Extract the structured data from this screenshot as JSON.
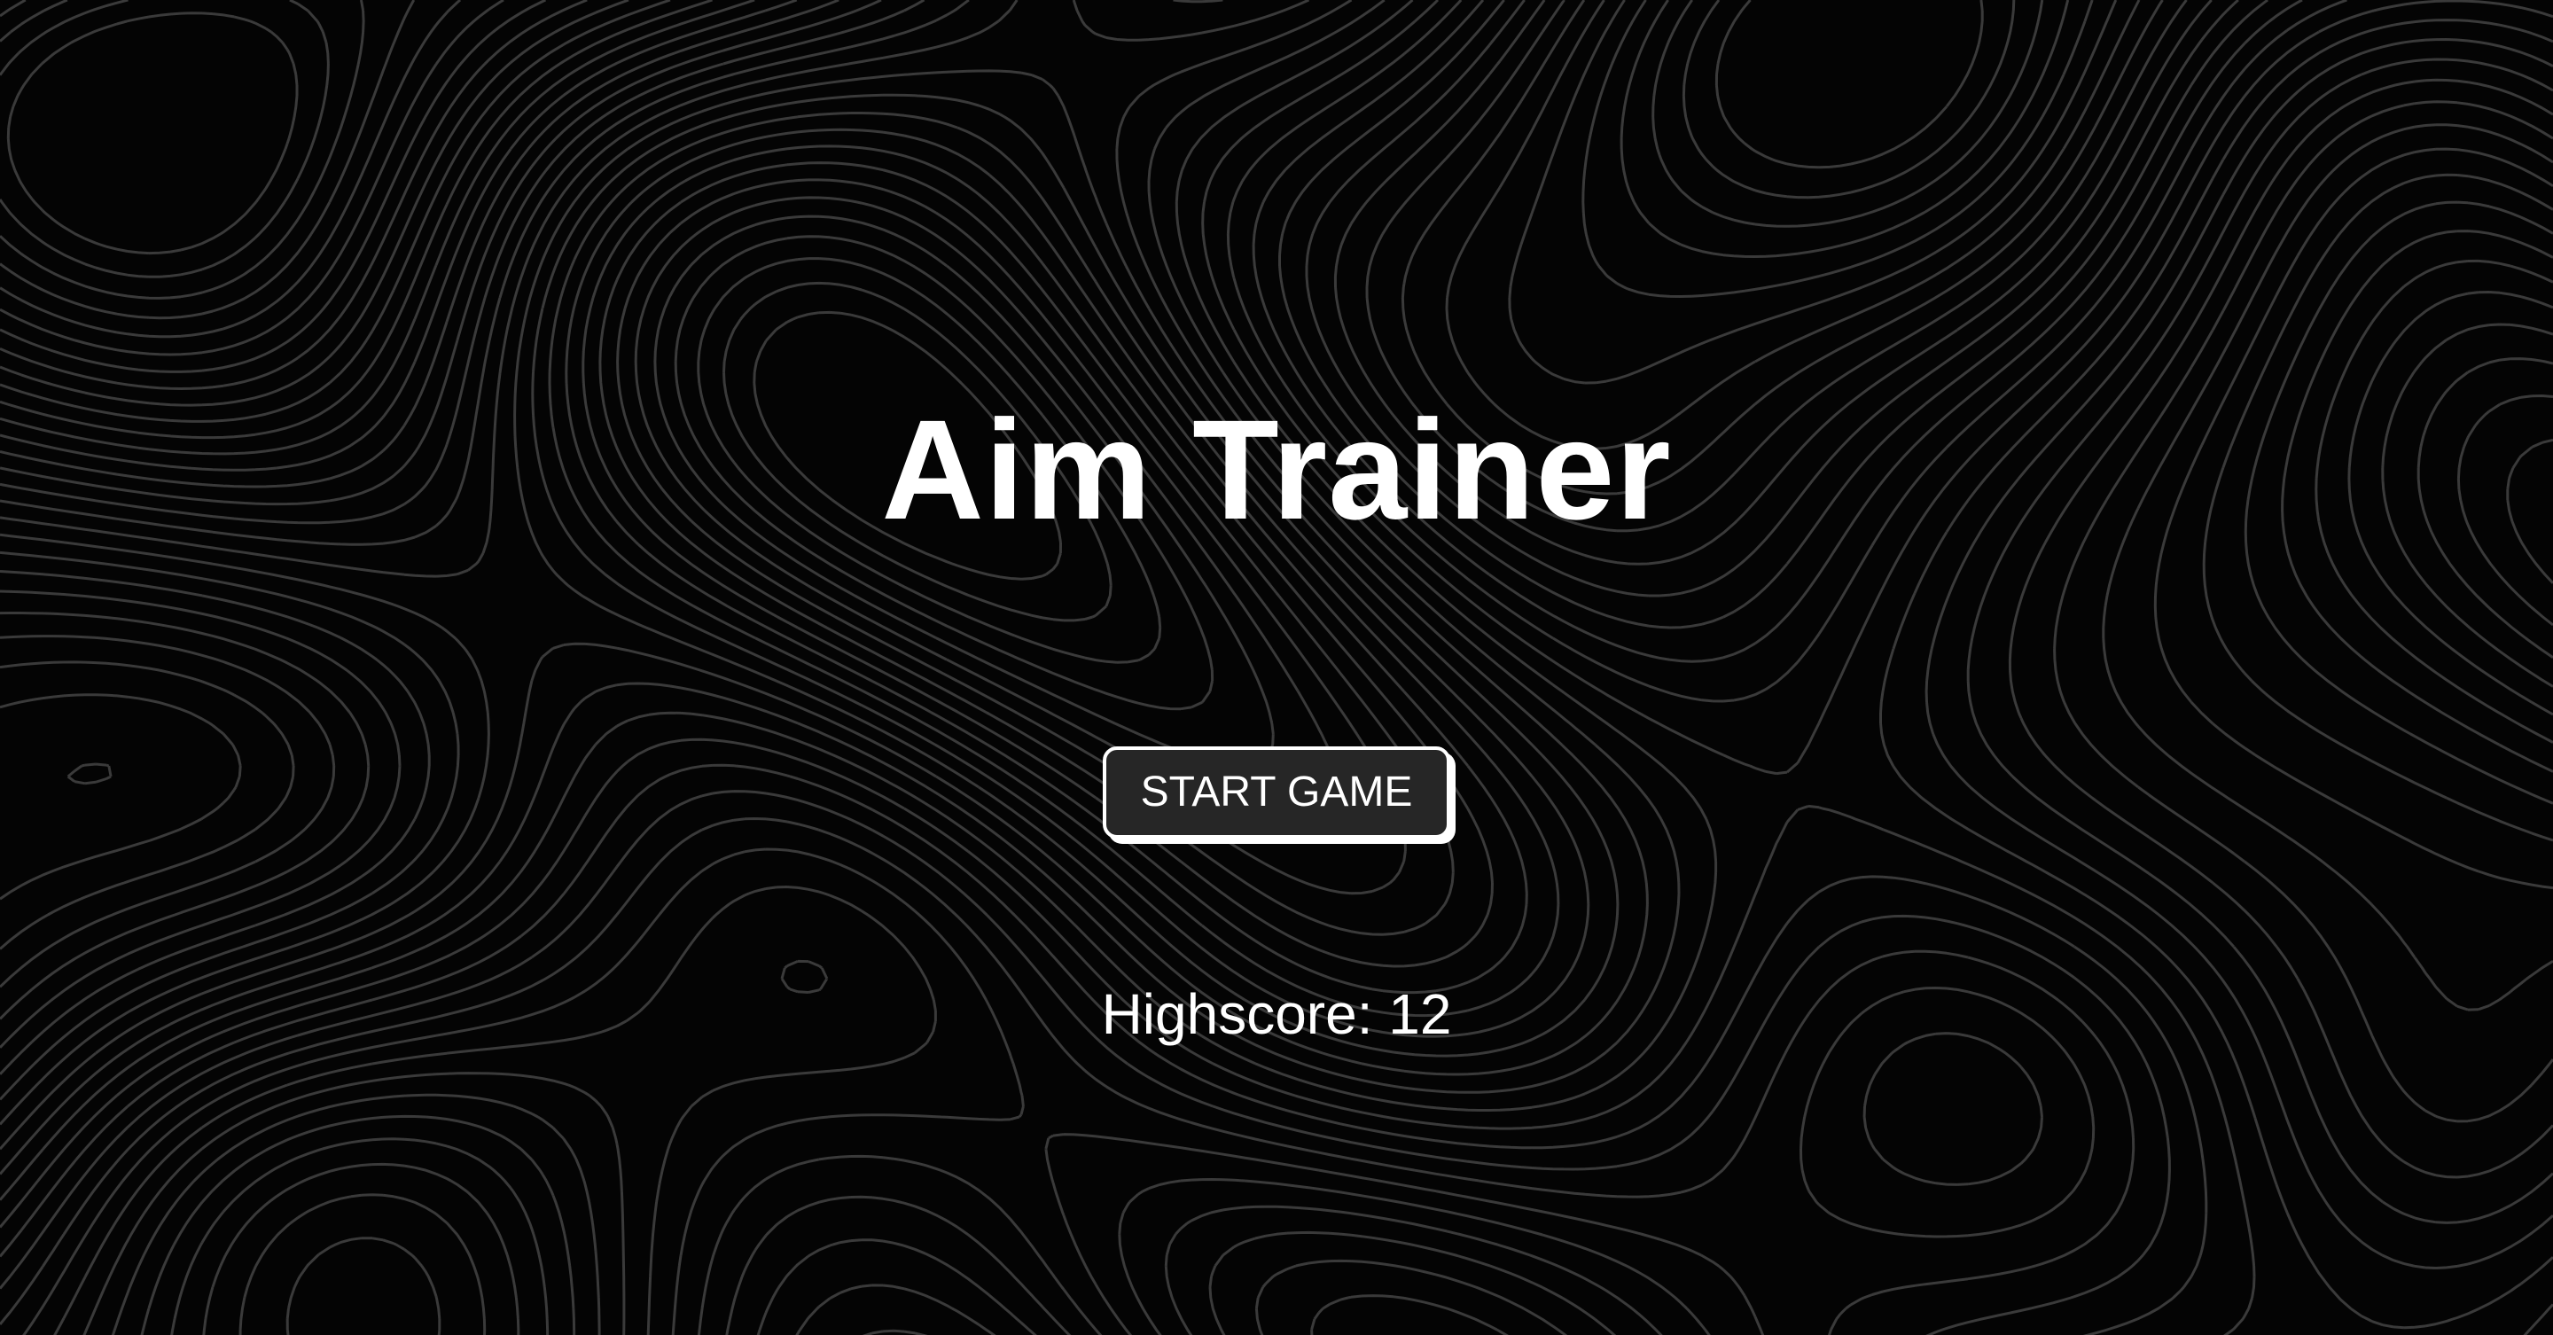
{
  "page": {
    "title": "Aim Trainer",
    "start_button_label": "START GAME",
    "highscore_label": "Highscore:",
    "highscore_value": "12"
  },
  "colors": {
    "background": "#040404",
    "contour_lines": "#3a3a3a",
    "text": "#ffffff",
    "button_fill": "#262626",
    "button_border": "#ffffff"
  },
  "background_pattern": "topographic-contour-lines"
}
